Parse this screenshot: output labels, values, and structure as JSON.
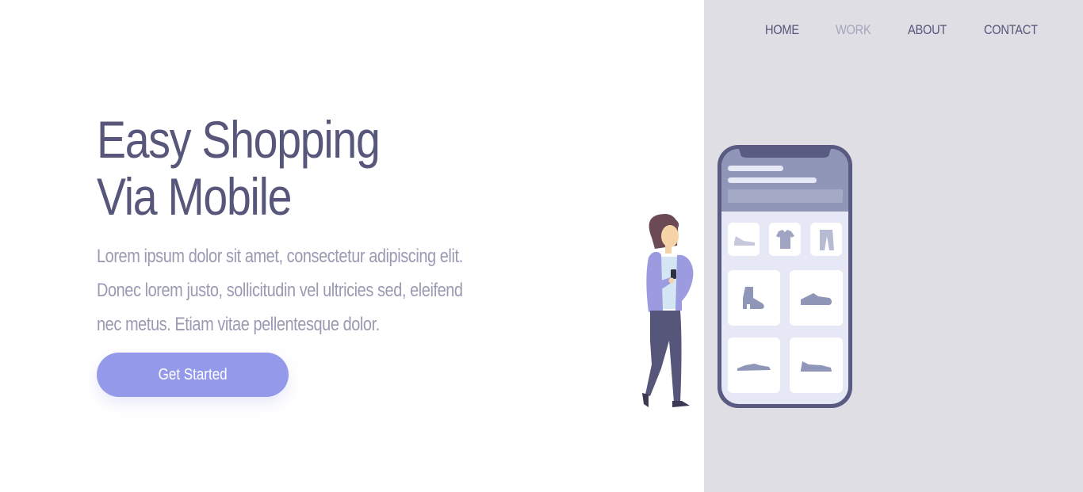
{
  "nav": {
    "items": [
      {
        "label": "HOME",
        "active": false
      },
      {
        "label": "WORK",
        "active": true
      },
      {
        "label": "ABOUT",
        "active": false
      },
      {
        "label": "CONTACT",
        "active": false
      }
    ]
  },
  "hero": {
    "title_line1": "Easy Shopping",
    "title_line2": "Via Mobile",
    "body": "Lorem ipsum dolor sit amet, consectetur adipiscing elit. Donec lorem justo, sollicitudin vel ultricies sed, eleifend nec metus. Etiam vitae pellentesque dolor.",
    "cta_label": "Get Started"
  },
  "colors": {
    "primary_text": "#56577a",
    "muted_text": "#9a9ab3",
    "accent": "#949ae9",
    "panel_bg": "#dfdee5"
  },
  "illustration": {
    "product_icons": [
      "sneaker-icon",
      "tshirt-icon",
      "pants-icon",
      "boot-icon",
      "shoe-icon",
      "sneaker-icon",
      "running-shoe-icon"
    ]
  }
}
